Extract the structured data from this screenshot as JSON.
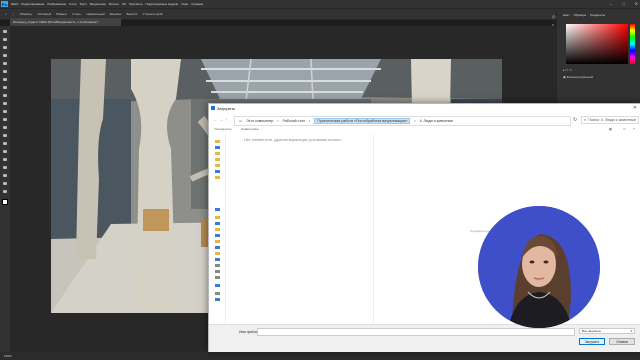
{
  "app": {
    "logo": "Ps",
    "menu": [
      "Файл",
      "Редактирование",
      "Изображение",
      "Слои",
      "Текст",
      "Выделение",
      "Фильтр",
      "3D",
      "Просмотр",
      "Подключаемые модули",
      "Окно",
      "Справка"
    ],
    "document_tab": "Интерьер_Сдар-Х 100% (Фото/Визуальность, 1 слой-маска) *",
    "options": [
      "Образец:",
      "Активный",
      "Размер:",
      "Стиль:",
      "Нормальный",
      "Ширина:",
      "Высота:",
      "Уточнить край"
    ],
    "share_label": "Поделиться"
  },
  "right_panel": {
    "tabs": [
      "Цвет",
      "Образцы",
      "Градиенты"
    ],
    "icons": [
      "gradients-icon",
      "layers-icon"
    ],
    "layer_label": "Фон/непрозрачный"
  },
  "status": {
    "zoom": "100%"
  },
  "dialog": {
    "title": "Загрузить",
    "breadcrumb": [
      "Этот компьютер",
      "Рабочий стол",
      "Практическая работа «Постобработка визуализации»",
      "4. Люди и животные"
    ],
    "search_placeholder": "Поиск: 4. Люди и животные",
    "commands": {
      "organize": "Упорядочить",
      "new_folder": "Новая папка"
    },
    "empty_message": "Нет элементов, удовлетворяющих условиям поиска.",
    "preview_text": "Предварительный просмотр недоступен.",
    "filename_label": "Имя файла:",
    "filename_value": "",
    "filter_value": "Все форматы",
    "open_label": "Загрузить",
    "cancel_label": "Отмена"
  },
  "colors": {
    "accent": "#1473e6",
    "webcam_bg": "#3f4fc9",
    "ps_logo": "#31a8ff"
  }
}
